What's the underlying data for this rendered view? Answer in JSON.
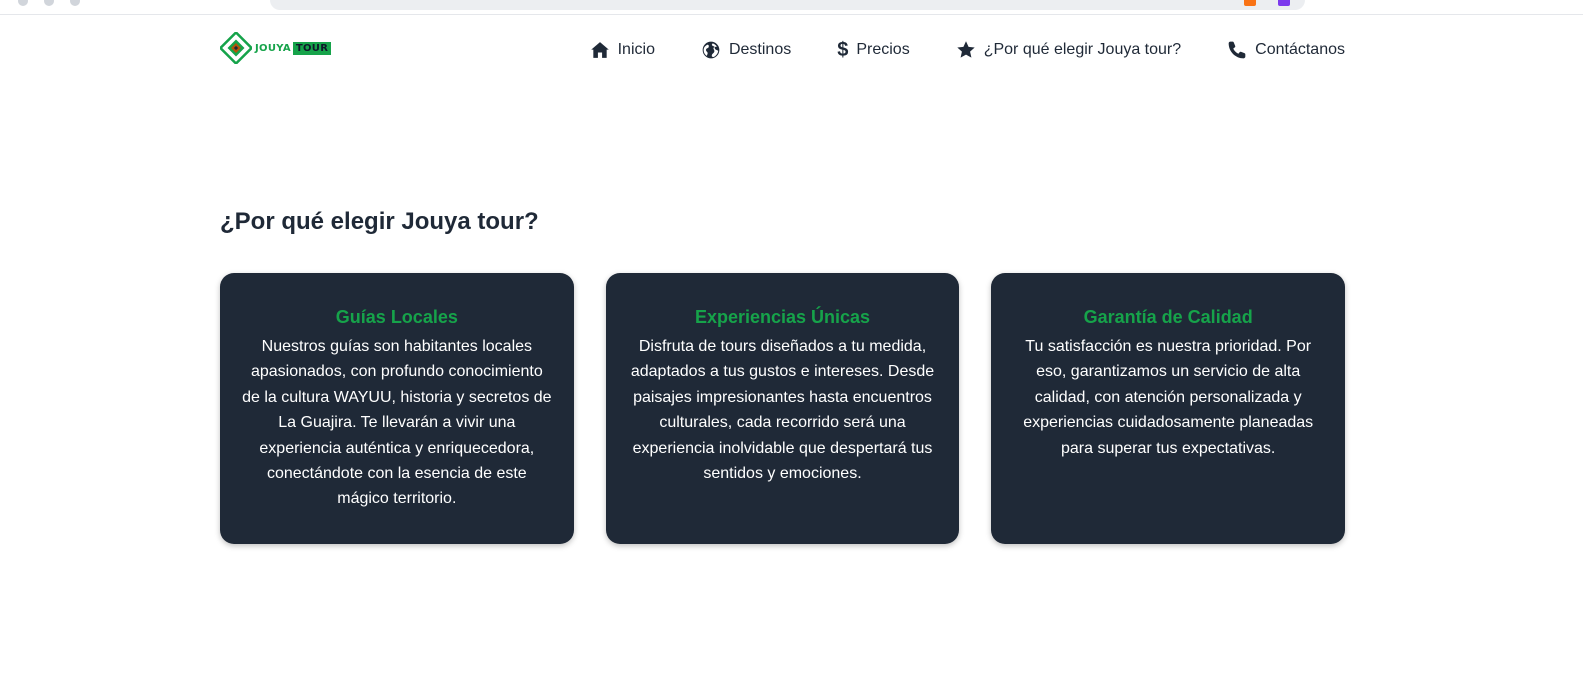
{
  "brand": {
    "word_1": "JOUYA",
    "word_2": "TOUR",
    "accent_color": "#16a34a"
  },
  "nav": {
    "items": [
      {
        "label": "Inicio",
        "icon": "home-icon"
      },
      {
        "label": "Destinos",
        "icon": "globe-icon"
      },
      {
        "label": "Precios",
        "icon": "dollar-icon"
      },
      {
        "label": "¿Por qué elegir Jouya tour?",
        "icon": "star-icon"
      },
      {
        "label": "Contáctanos",
        "icon": "phone-icon"
      }
    ]
  },
  "section": {
    "title": "¿Por qué elegir Jouya tour?"
  },
  "cards": [
    {
      "title": "Guías Locales",
      "text": "Nuestros guías son habitantes locales apasionados, con profundo conocimiento de la cultura WAYUU, historia y secretos de La Guajira. Te llevarán a vivir una experiencia auténtica y enriquecedora, conectándote con la esencia de este mágico territorio."
    },
    {
      "title": "Experiencias Únicas",
      "text": "Disfruta de tours diseñados a tu medida, adaptados a tus gustos e intereses. Desde paisajes impresionantes hasta encuentros culturales, cada recorrido será una experiencia inolvidable que despertará tus sentidos y emociones."
    },
    {
      "title": "Garantía de Calidad",
      "text": "Tu satisfacción es nuestra prioridad. Por eso, garantizamos un servicio de alta calidad, con atención personalizada y experiencias cuidadosamente planeadas para superar tus expectativas."
    }
  ],
  "colors": {
    "card_bg": "#1f2937",
    "card_title": "#16a34a",
    "text_dark": "#1f2937"
  }
}
